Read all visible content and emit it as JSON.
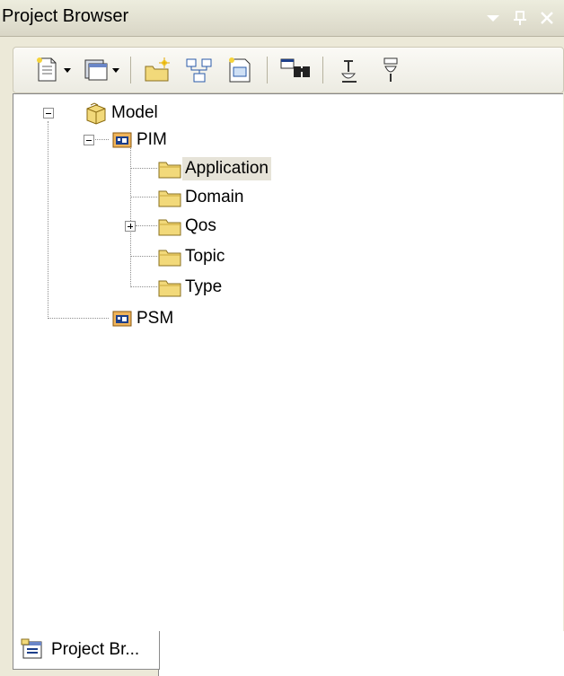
{
  "window": {
    "title": "Project Browser",
    "controls": [
      {
        "name": "dropdown-icon"
      },
      {
        "name": "pin-icon"
      },
      {
        "name": "close-icon"
      }
    ]
  },
  "toolbar": {
    "buttons": [
      "new-element-dropdown-icon",
      "new-diagram-dropdown-icon",
      "new-package-icon",
      "new-element-icon",
      "new-diagram-icon",
      "find-icon",
      "move-up-icon",
      "move-down-icon"
    ]
  },
  "tree": {
    "items": [
      {
        "label": "Model",
        "icon": "model-package-icon",
        "level": 0,
        "expander": "minus"
      },
      {
        "label": "PIM",
        "icon": "view-package-icon",
        "level": 1,
        "expander": "minus"
      },
      {
        "label": "Application",
        "icon": "folder-icon",
        "level": 2,
        "selected": true
      },
      {
        "label": "Domain",
        "icon": "folder-icon",
        "level": 2
      },
      {
        "label": "Qos",
        "icon": "folder-icon",
        "level": 2,
        "expander": "plus"
      },
      {
        "label": "Topic",
        "icon": "folder-icon",
        "level": 2
      },
      {
        "label": "Type",
        "icon": "folder-icon",
        "level": 2
      },
      {
        "label": "PSM",
        "icon": "view-package-icon",
        "level": 1
      }
    ]
  },
  "tabs": [
    {
      "label": "Project Br...",
      "icon": "project-browser-icon",
      "active": true
    }
  ],
  "colors": {
    "chrome": "#ece9d8",
    "selection": "#e6e3d8",
    "folder": "#f2d97a"
  }
}
